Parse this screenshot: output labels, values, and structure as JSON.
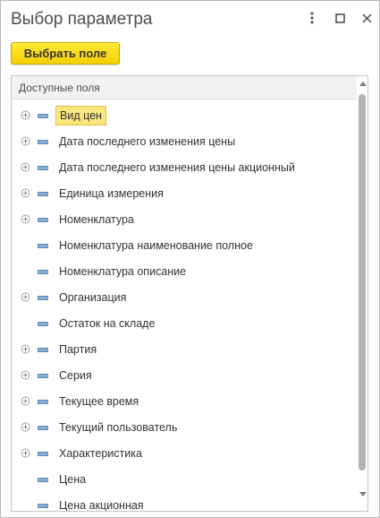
{
  "window": {
    "title": "Выбор параметра"
  },
  "toolbar": {
    "select_label": "Выбрать поле"
  },
  "table": {
    "header": "Доступные поля",
    "rows": [
      {
        "label": "Вид цен",
        "expandable": true,
        "selected": true
      },
      {
        "label": "Дата последнего изменения цены",
        "expandable": true,
        "selected": false
      },
      {
        "label": "Дата последнего изменения цены акционный",
        "expandable": true,
        "selected": false
      },
      {
        "label": "Единица измерения",
        "expandable": true,
        "selected": false
      },
      {
        "label": "Номенклатура",
        "expandable": true,
        "selected": false
      },
      {
        "label": "Номенклатура наименование полное",
        "expandable": false,
        "selected": false
      },
      {
        "label": "Номенклатура описание",
        "expandable": false,
        "selected": false
      },
      {
        "label": "Организация",
        "expandable": true,
        "selected": false
      },
      {
        "label": "Остаток на складе",
        "expandable": false,
        "selected": false
      },
      {
        "label": "Партия",
        "expandable": true,
        "selected": false
      },
      {
        "label": "Серия",
        "expandable": true,
        "selected": false
      },
      {
        "label": "Текущее время",
        "expandable": true,
        "selected": false
      },
      {
        "label": "Текущий пользователь",
        "expandable": true,
        "selected": false
      },
      {
        "label": "Характеристика",
        "expandable": true,
        "selected": false
      },
      {
        "label": "Цена",
        "expandable": false,
        "selected": false
      },
      {
        "label": "Цена акционная",
        "expandable": false,
        "selected": false
      }
    ]
  }
}
